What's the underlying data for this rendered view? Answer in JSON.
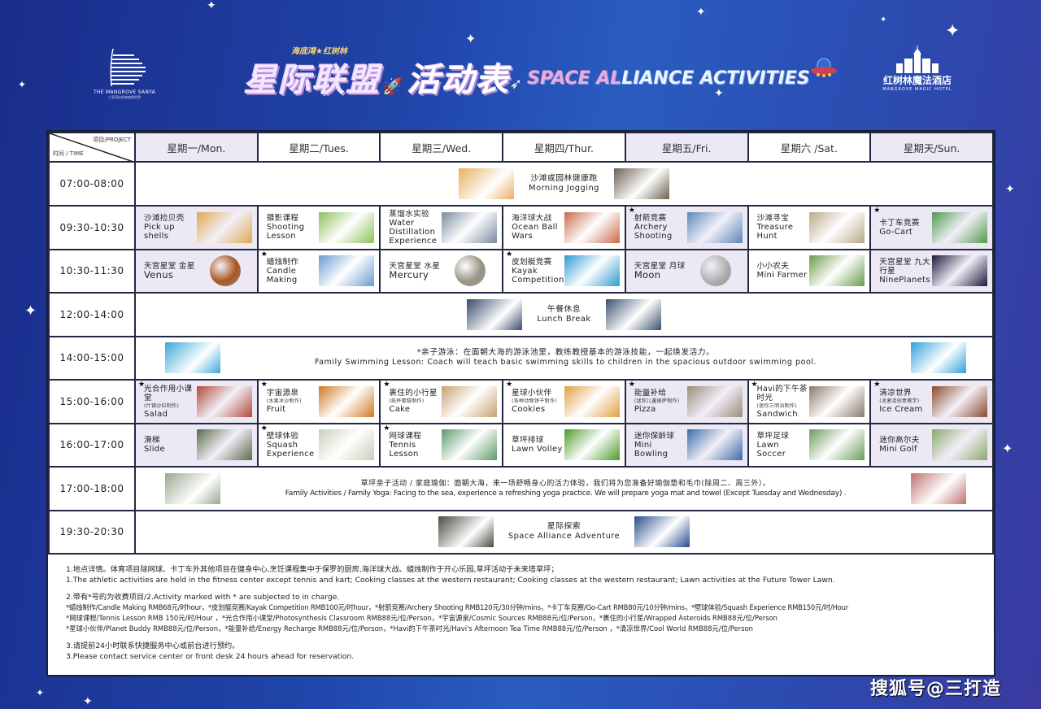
{
  "header": {
    "left_logo": {
      "name": "THE MANGROVE SANYA",
      "sub": "三亚湾红树林度假世界"
    },
    "title_small": "海底湾★红树林",
    "title_cn_part1": "星际联盟",
    "title_cn_part2": "活动表",
    "title_en_highlight": "SPACE AL",
    "title_en_rest": "LIANCE ACTIVITIES",
    "right_logo": {
      "cn": "红树林魔法酒店",
      "en": "MANGROVE MAGIC HOTEL"
    }
  },
  "table": {
    "corner": {
      "project": "项目/PROJECT",
      "time": "时间 / TIME"
    },
    "days": [
      "星期一/Mon.",
      "星期二/Tues.",
      "星期三/Wed.",
      "星期四/Thur.",
      "星期五/Fri.",
      "星期六 /Sat.",
      "星期天/Sun."
    ],
    "rows": [
      {
        "time": "07:00-08:00",
        "span": {
          "cn": "沙滩或园林健康跑",
          "en": "Morning  Jogging"
        }
      },
      {
        "time": "09:30-10:30",
        "cells": [
          {
            "star": false,
            "cn": "沙滩捡贝壳",
            "en": "Pick up shells",
            "thumb": "#e0a850"
          },
          {
            "star": false,
            "cn": "摄影课程",
            "en": "Shooting Lesson",
            "thumb": "#8cbf5a"
          },
          {
            "star": false,
            "cn": "蒸馏水实验",
            "en": "Water Distillation Experience",
            "thumb": "#7a8aa0"
          },
          {
            "star": false,
            "cn": "海洋球大战",
            "en": "Ocean Ball Wars",
            "thumb": "#c86a4a"
          },
          {
            "star": true,
            "cn": "射箭竞赛",
            "en": "Archery Shooting",
            "thumb": "#5a86b8"
          },
          {
            "star": false,
            "cn": "沙滩寻宝",
            "en": "Treasure Hunt",
            "thumb": "#b8a888"
          },
          {
            "star": true,
            "cn": "卡丁车竞赛",
            "en": "Go-Cart",
            "thumb": "#4e9a4a"
          }
        ]
      },
      {
        "time": "10:30-11:30",
        "cells": [
          {
            "star": false,
            "cn": "天宫星堂 金星",
            "en": "Venus",
            "thumb": "#a8561e",
            "round": true
          },
          {
            "star": true,
            "cn": "蜡烛制作",
            "en": "Candle Making",
            "thumb": "#6a9ad0"
          },
          {
            "star": false,
            "cn": "天宫星堂 水星",
            "en": "Mercury",
            "thumb": "#9a9484",
            "round": true
          },
          {
            "star": true,
            "cn": "皮划艇竞赛",
            "en": "Kayak Competition",
            "thumb": "#2e9ad0"
          },
          {
            "star": false,
            "cn": "天宫星堂 月球",
            "en": "Moon",
            "thumb": "#b0b0b0",
            "round": true
          },
          {
            "star": false,
            "cn": "小小农夫",
            "en": "Mini Farmer",
            "thumb": "#6a9a4a"
          },
          {
            "star": false,
            "cn": "天宫星堂 九大行星",
            "en": "NinePlanets",
            "thumb": "#1a1a3a"
          }
        ]
      },
      {
        "time": "12:00-14:00",
        "span": {
          "cn": "午餐休息",
          "en": "Lunch Break"
        }
      },
      {
        "time": "14:00-15:00",
        "span": {
          "star": true,
          "cn": "亲子游泳：在面朝大海的游泳池里，教练教授基本的游泳技能，一起焕发活力。",
          "en": "Family Swimming Lesson: Coach will teach basic swimming skills to children in the spacious outdoor swimming pool."
        }
      },
      {
        "time": "15:00-16:00",
        "cells": [
          {
            "star": true,
            "cn": "光合作用小课堂",
            "note": "(什锦沙拉制作)",
            "en": "Salad",
            "thumb": "#b04a3a"
          },
          {
            "star": true,
            "cn": "宇宙源泉",
            "note": "(水果冰沙制作)",
            "en": "Fruit",
            "thumb": "#d07a20"
          },
          {
            "star": true,
            "cn": "裹住的小行星",
            "note": "(纸杯蛋糕制作)",
            "en": "Cake",
            "thumb": "#c8a070"
          },
          {
            "star": true,
            "cn": "星球小伙伴",
            "note": "(各种动物饼干制作)",
            "en": "Cookies",
            "thumb": "#e0a040"
          },
          {
            "star": true,
            "cn": "能量补给",
            "note": "(迷你儿童披萨制作)",
            "en": "Pizza",
            "thumb": "#9a8a7a"
          },
          {
            "star": true,
            "cn": "Havi的下午茶时光",
            "note": "(迷你三明治制作)",
            "en": "Sandwich",
            "thumb": "#8a7a6a"
          },
          {
            "star": true,
            "cn": "清凉世界",
            "note": "(冰激凌创意教学)",
            "en": "Ice Cream",
            "thumb": "#8a4a2a"
          }
        ]
      },
      {
        "time": "16:00-17:00",
        "cells": [
          {
            "star": false,
            "cn": "滑梯",
            "en": "Slide",
            "thumb": "#5a6a4a"
          },
          {
            "star": true,
            "cn": "壁球体验",
            "en": "Squash Experience",
            "thumb": "#c8d0b8"
          },
          {
            "star": true,
            "cn": "网球课程",
            "en": "Tennis Lesson",
            "thumb": "#5a9a6a"
          },
          {
            "star": false,
            "cn": "草坪排球",
            "en": "Lawn Volley",
            "thumb": "#4a9a2a"
          },
          {
            "star": false,
            "cn": "迷你保龄球",
            "en": "Mini Bowling",
            "thumb": "#3a6aa8"
          },
          {
            "star": false,
            "cn": "草坪足球",
            "en": "Lawn Soccer",
            "thumb": "#6a9a5a"
          },
          {
            "star": false,
            "cn": "迷你高尔夫",
            "en": "Mini Golf",
            "thumb": "#8aa86a"
          }
        ]
      },
      {
        "time": "17:00-18:00",
        "span": {
          "cn": "草坪亲子活动 / 家庭瑜伽：面朝大海，来一场舒畅身心的活力体验，我们将为您准备好瑜伽垫和毛巾(除周二、周三外）。",
          "en": "Family Activities / Family Yoga: Facing to the sea, experience a refreshing yoga practice. We will prepare yoga mat and towel (Except Tuesday and Wednesday) ."
        }
      },
      {
        "time": "19:30-20:30",
        "span": {
          "cn": "星际探索",
          "en": "Space Alliance Adventure"
        }
      }
    ]
  },
  "notes": {
    "n1_cn": "1.地点详情。体育项目除网球、卡丁车外其他项目在健身中心,烹饪课程集中于保罗的厨房,海洋球大战、蜡烛制作于开心乐园,草坪活动于未来塔草坪；",
    "n1_en": "1.The athletic activities are held in the fitness center except tennis and kart; Cooking classes at the western restaurant; Cooking classes at the western restaurant; Lawn activities at the Future Tower Lawn.",
    "n2_title": "2.带有*号的为收费项目/2.Activity marked with * are subjected to in charge.",
    "n2_l1": "*蜡烛制作/Candle Making RMB68元/时hour，*皮划艇竞赛/Kayak Competition RMB100元/时hour，*射箭竞赛/Archery Shooting RMB120元/30分钟/mins，*卡丁车竞赛/Go-Cart  RMB80元/10分钟/mins，*壁球体验/Squash Experience RMB150元/时/Hour",
    "n2_l2": "*网球课程/Tennis Lesson   RMB 150元/时/Hour ，*光合作用小课堂/Photosynthesis Classroom  RMB88元/位/Person，*宇宙源泉/Cosmic Sources  RMB88元/位/Person，*裹住的小行星/Wrapped Asteroids  RMB88元/位/Person",
    "n2_l3": "*星球小伙伴/Planet Buddy   RMB88元/位/Person，*能量补给/Energy Recharge  RMB88元/位/Person，*Havi的下午茶时光/Havi's Afternoon Tea Time  RMB88元/位/Person ，*清凉世界/Cool World  RMB88元/位/Person",
    "n3_cn": "3.请提前24小时联系快捷服务中心或前台进行预约。",
    "n3_en": "3.Please contact service center or front desk 24 hours ahead for reservation."
  },
  "watermark": "搜狐号@三打造",
  "span_thumbs": {
    "row0": [
      "#e8b060",
      "#6a6050"
    ],
    "row3": [
      "#3a4a6a",
      "#3a5070"
    ],
    "row4": [
      "#3aa8d8",
      "#30a0d8"
    ],
    "row7": [
      "#9aa890",
      "#c07070"
    ],
    "row8": [
      "#4a4a40",
      "#2a4a8a"
    ]
  }
}
